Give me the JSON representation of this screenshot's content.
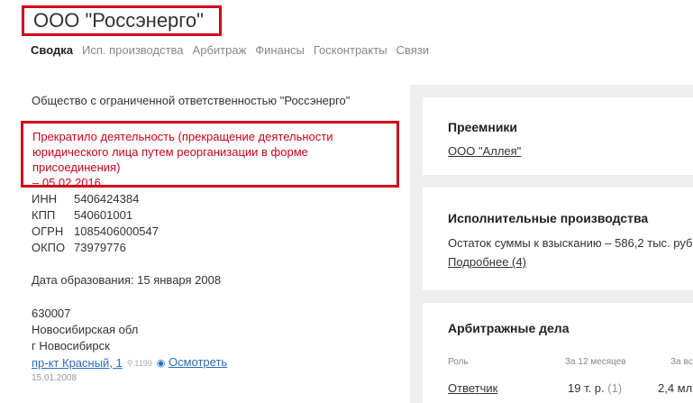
{
  "header": {
    "title": "ООО \"Россэнерго\"",
    "tabs": [
      "Сводка",
      "Исп. производства",
      "Арбитраж",
      "Финансы",
      "Госконтракты",
      "Связи"
    ]
  },
  "company": {
    "full_name": "Общество с ограниченной ответственностью \"Россэнерго\"",
    "status_lines": [
      "Прекратило деятельность (прекращение деятельности",
      "юридического лица путем реорганизации в форме присоединения)",
      "– 05.02.2016"
    ],
    "codes": [
      {
        "label": "ИНН",
        "value": "5406424384"
      },
      {
        "label": "КПП",
        "value": "540601001"
      },
      {
        "label": "ОГРН",
        "value": "1085406000547"
      },
      {
        "label": "ОКПО",
        "value": "73979776"
      }
    ],
    "founded_label": "Дата образования:",
    "founded_value": "15 января 2008",
    "address": {
      "zip": "630007",
      "region": "Новосибирская обл",
      "city": "г Новосибирск",
      "street_link": "пр-кт Красный, 1",
      "count": "1199",
      "view_link": "Осмотреть",
      "date": "15.01.2008"
    }
  },
  "successors": {
    "title": "Преемники",
    "link": "ООО \"Аллея\""
  },
  "enforcement": {
    "title": "Исполнительные производства",
    "text": "Остаток суммы к взысканию – 586,2 тыс. руб.",
    "link": "Подробнее (4)"
  },
  "arbitration": {
    "title": "Арбитражные дела",
    "headers": [
      "Роль",
      "За 12 месяцев",
      "За вс"
    ],
    "row": {
      "role": "Ответчик",
      "year": "19 т. р.",
      "year_count": "(1)",
      "all": "2,4 мл"
    }
  }
}
